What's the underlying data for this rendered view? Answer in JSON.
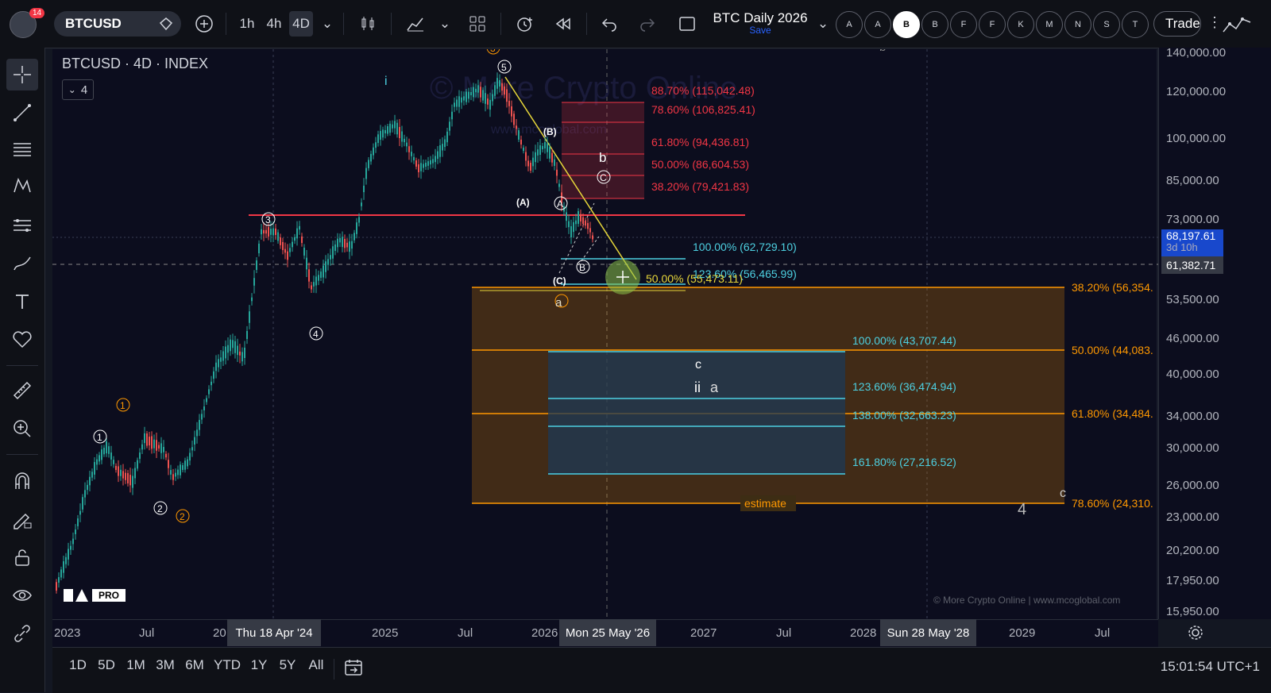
{
  "header": {
    "notification_count": "14",
    "symbol": "BTCUSD",
    "intervals": [
      "1h",
      "4h",
      "4D"
    ],
    "layout_title": "BTC Daily 2026",
    "layout_save": "Save",
    "alert_letters": [
      "A",
      "A",
      "B",
      "B",
      "F",
      "F",
      "K",
      "M",
      "N",
      "S",
      "T"
    ],
    "trade_label": "Trade"
  },
  "chart": {
    "legend_title": "BTCUSD · 4D · INDEX",
    "legend_toggle": "4",
    "watermark": "© More Crypto Online",
    "watermark_url": "www.mcoglobal.com",
    "footer_watermark": "© More Crypto Online  |  www.mcoglobal.com",
    "wave_labels": {
      "i": "i",
      "b": "b",
      "B_paren": "(B)",
      "A_paren": "(A)",
      "C_paren": "(C)",
      "c_circle": "C",
      "A_circle": "A",
      "B_circle": "B",
      "one": "1",
      "two": "2",
      "three": "3",
      "four": "4",
      "five": "5",
      "orange_one": "1",
      "orange_two": "2",
      "orange_three": "3",
      "orange_a": "a",
      "c": "c",
      "ii": "ii",
      "a": "a",
      "c_right": "c",
      "four_right": "4",
      "b_top": "b"
    },
    "fib_red": [
      "88.70% (115,042.48)",
      "78.60% (106,825.41)",
      "61.80% (94,436.81)",
      "50.00% (86,604.53)",
      "38.20% (79,421.83)"
    ],
    "fib_cyan_small": [
      "100.00% (62,729.10)",
      "123.60% (56,465.99)"
    ],
    "fib_yellow_small": "50.00% (55,473.11)",
    "fib_orange": [
      "38.20% (56,354.",
      "50.00% (44,083.",
      "61.80% (34,484.",
      "78.60% (24,310."
    ],
    "fib_cyan_big": [
      "100.00% (43,707.44)",
      "123.60% (36,474.94)",
      "138.00% (32,663.23)",
      "161.80% (27,216.52)"
    ],
    "estimate": "estimate",
    "price_axis": [
      "140,000.00",
      "120,000.00",
      "100,000.00",
      "85,000.00",
      "73,000.00",
      "53,500.00",
      "46,000.00",
      "40,000.00",
      "34,000.00",
      "30,000.00",
      "26,000.00",
      "23,000.00",
      "20,200.00",
      "17,950.00",
      "15,950.00"
    ],
    "current_price": "68,197.61",
    "countdown": "3d 10h",
    "crosshair_price": "61,382.71",
    "time_axis": [
      "2023",
      "Jul",
      "20",
      "2025",
      "Jul",
      "2026",
      "2027",
      "Jul",
      "2028",
      "2029",
      "Jul"
    ],
    "time_highlights": [
      "Thu 18 Apr '24",
      "Mon 25 May '26",
      "Sun 28 May '28"
    ],
    "tv_logo": "PRO"
  },
  "bottom": {
    "ranges": [
      "1D",
      "5D",
      "1M",
      "3M",
      "6M",
      "YTD",
      "1Y",
      "5Y",
      "All"
    ],
    "clock": "15:01:54 UTC+1"
  },
  "colors": {
    "red": "#f23645",
    "orange": "#ff9800",
    "cyan": "#4dd0e1",
    "yellow": "#e6d63a",
    "bg": "#0c0d1e"
  }
}
